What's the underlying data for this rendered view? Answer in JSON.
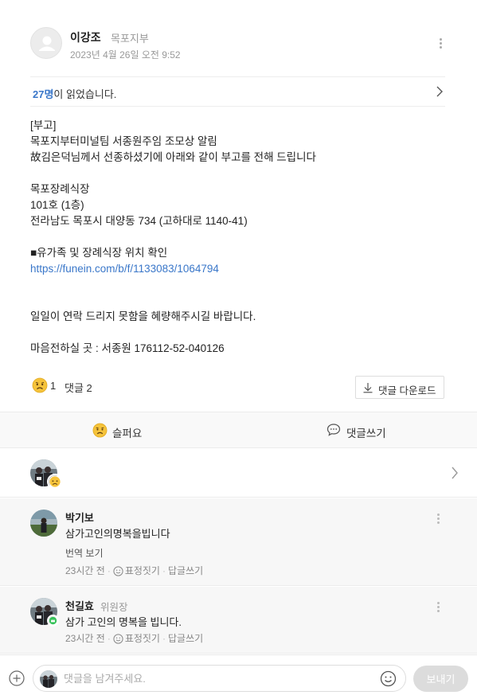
{
  "post": {
    "author_name": "이강조",
    "author_group": "목포지부",
    "date": "2023년 4월 26일 오전 9:52"
  },
  "read_status": {
    "count": "27명",
    "suffix": "이 읽었습니다."
  },
  "body": {
    "lines": [
      "[부고]",
      "목포지부터미널팀 서종원주임 조모상 알림",
      "故김은덕님께서 선종하셨기에 아래와 같이 부고를 전해 드립니다",
      "",
      "목포장례식장",
      "101호 (1층)",
      "전라남도 목포시 대양동 734 (고하대로 1140-41)",
      "",
      "■유가족 및 장례식장 위치 확인"
    ],
    "link": "https://funein.com/b/f/1133083/1064794",
    "lines_after": [
      "",
      "",
      "일일이 연락 드리지 못함을 혜량해주시길 바랍니다.",
      "",
      "마음전하실 곳 : 서종원 176112-52-040126"
    ]
  },
  "reactions": {
    "emotion_count": "1",
    "comment_label": "댓글 2",
    "download_label": "댓글 다운로드"
  },
  "actions": {
    "sad_label": "슬퍼요",
    "comment_label": "댓글쓰기"
  },
  "comments": [
    {
      "name": "박기보",
      "role": "",
      "text": "삼가고인의명복을빕니다",
      "translate": "번역 보기",
      "time": "23시간 전",
      "react": "표정짓기",
      "reply": "답글쓰기"
    },
    {
      "name": "천길효",
      "role": "위원장",
      "text": "삼가 고인의 명복을 빕니다.",
      "translate": "",
      "time": "23시간 전",
      "react": "표정짓기",
      "reply": "답글쓰기"
    }
  ],
  "input": {
    "placeholder": "댓글을 남겨주세요.",
    "send_label": "보내기"
  },
  "colors": {
    "accent": "#3a77c9",
    "emoji_yellow": "#f5c33b",
    "badge_green": "#36c25a"
  },
  "icons": [
    "more-icon",
    "chevron-right-icon",
    "sad-emoji-icon",
    "download-icon",
    "speech-bubble-icon",
    "smile-icon",
    "plus-icon",
    "user-placeholder-icon"
  ]
}
